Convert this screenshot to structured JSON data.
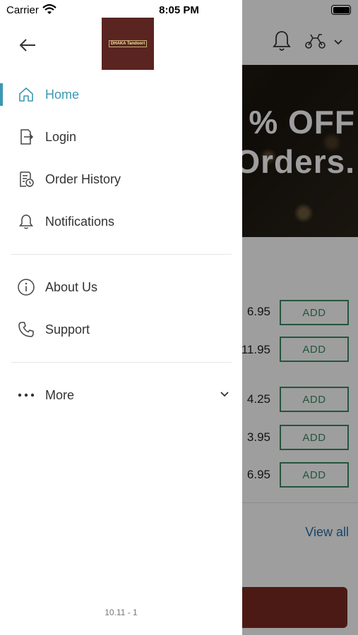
{
  "status_bar": {
    "carrier": "Carrier",
    "time": "8:05 PM"
  },
  "background": {
    "banner_line1": "% OFF",
    "banner_line2": "Orders.",
    "prices": [
      "6.95",
      "11.95",
      "4.25",
      "3.95",
      "6.95"
    ],
    "add_label": "ADD",
    "view_all": "View all"
  },
  "drawer": {
    "logo_text": "DHAKA Tandoori",
    "menu": [
      {
        "label": "Home",
        "icon": "home-icon",
        "active": true
      },
      {
        "label": "Login",
        "icon": "login-icon"
      },
      {
        "label": "Order History",
        "icon": "order-history-icon"
      },
      {
        "label": "Notifications",
        "icon": "bell-icon"
      },
      {
        "label": "About Us",
        "icon": "info-icon"
      },
      {
        "label": "Support",
        "icon": "phone-icon"
      },
      {
        "label": "More",
        "icon": "more-dots-icon"
      }
    ],
    "version": "10.11 - 1"
  },
  "colors": {
    "accent": "#3c97b3",
    "add_green": "#3a8a63",
    "brand": "#7b2a22",
    "link": "#2a6fa8"
  }
}
